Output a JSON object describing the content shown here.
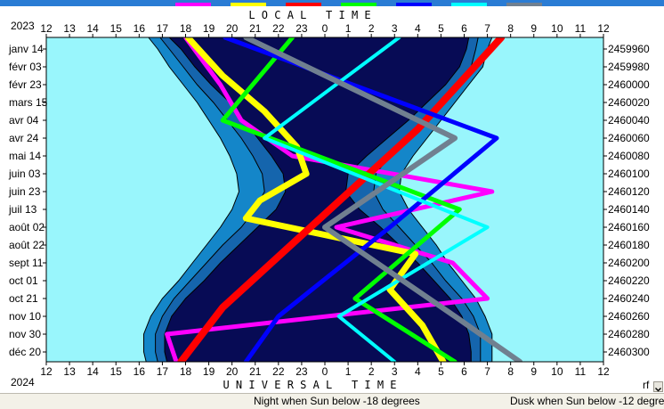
{
  "colors": {
    "outside": "#99f6fc",
    "night": "#070b55",
    "twilight_mid": "#1565ad",
    "twilight_outer": "#1486c9",
    "title_bar": "#2a7cd4"
  },
  "legend_bar": {
    "colors": [
      "#ff00ff",
      "#ffff00",
      "#ff0000",
      "#00ff00",
      "#0000ff",
      "#00ffff",
      "#708090"
    ]
  },
  "chart_data": {
    "type": "area",
    "title_top": "LOCAL TIME",
    "title_bottom": "UNIVERSAL TIME",
    "year_top": "2023",
    "year_bottom": "2024",
    "corner_label": "rf",
    "x_ticks_top": [
      "12",
      "13",
      "14",
      "15",
      "16",
      "17",
      "18",
      "19",
      "20",
      "21",
      "22",
      "23",
      "0",
      "1",
      "2",
      "3",
      "4",
      "5",
      "6",
      "7",
      "8",
      "9",
      "10",
      "11",
      "12"
    ],
    "x_ticks_bottom": [
      "12",
      "13",
      "14",
      "15",
      "16",
      "17",
      "18",
      "19",
      "20",
      "21",
      "22",
      "23",
      "0",
      "1",
      "2",
      "3",
      "4",
      "5",
      "6",
      "7",
      "8",
      "9",
      "10",
      "11",
      "12"
    ],
    "y_ticks_left": [
      "janv 14",
      "févr 03",
      "févr 23",
      "mars 15",
      "avr 04",
      "avr 24",
      "mai 14",
      "juin 03",
      "juin 23",
      "juil 13",
      "août 02",
      "août 22",
      "sept 11",
      "oct 01",
      "oct 21",
      "nov 10",
      "nov 30",
      "déc 20"
    ],
    "y_ticks_right": [
      "2459960",
      "2459980",
      "2460000",
      "2460020",
      "2460040",
      "2460060",
      "2460080",
      "2460100",
      "2460120",
      "2460140",
      "2460160",
      "2460180",
      "2460200",
      "2460220",
      "2460240",
      "2460260",
      "2460280",
      "2460300"
    ],
    "xlim_hours": [
      12,
      36
    ],
    "ylim_julian_day": [
      2459947,
      2460311
    ],
    "night_boundary": {
      "julian_day": [
        2459947,
        2459960,
        2459980,
        2460000,
        2460020,
        2460040,
        2460060,
        2460080,
        2460100,
        2460120,
        2460140,
        2460160,
        2460180,
        2460200,
        2460220,
        2460240,
        2460260,
        2460280,
        2460300,
        2460311
      ],
      "dusk_18": [
        17.3,
        17.8,
        18.4,
        19.1,
        19.9,
        20.5,
        21.1,
        21.7,
        22.2,
        22.3,
        21.9,
        21.1,
        20.3,
        19.5,
        18.8,
        18.0,
        17.4,
        17.1,
        17.1,
        17.2
      ],
      "dawn_18": [
        30.2,
        30.1,
        29.8,
        29.2,
        28.4,
        27.6,
        26.7,
        25.8,
        25.0,
        24.9,
        25.5,
        26.4,
        27.2,
        28.0,
        28.7,
        29.4,
        29.9,
        30.2,
        30.3,
        30.3
      ],
      "dusk_12": [
        16.9,
        17.3,
        17.9,
        18.5,
        19.2,
        19.8,
        20.4,
        20.9,
        21.3,
        21.4,
        21.0,
        20.4,
        19.6,
        18.9,
        18.2,
        17.5,
        17.0,
        16.7,
        16.7,
        16.8
      ],
      "dawn_12": [
        30.6,
        30.5,
        30.3,
        29.7,
        29.0,
        28.3,
        27.5,
        26.8,
        26.2,
        26.1,
        26.5,
        27.2,
        27.9,
        28.6,
        29.2,
        29.9,
        30.4,
        30.7,
        30.7,
        30.7
      ],
      "dusk_6": [
        16.4,
        16.8,
        17.3,
        17.9,
        18.5,
        19.0,
        19.5,
        19.9,
        20.2,
        20.3,
        20.0,
        19.5,
        18.9,
        18.3,
        17.7,
        17.0,
        16.5,
        16.2,
        16.2,
        16.3
      ],
      "dawn_6": [
        31.2,
        31.0,
        30.8,
        30.2,
        29.6,
        29.0,
        28.4,
        27.8,
        27.3,
        27.2,
        27.6,
        28.2,
        28.8,
        29.3,
        29.9,
        30.5,
        30.9,
        31.2,
        31.2,
        31.2
      ]
    },
    "planet_series": [
      {
        "color": "#ff00ff",
        "width": 5,
        "kind": "wavy",
        "julian_day": [
          2459947,
          2460000,
          2460040,
          2460080,
          2460120,
          2460160,
          2460200,
          2460240,
          2460280,
          2460311
        ],
        "hour": [
          18.0,
          19.5,
          20.4,
          22.6,
          31.2,
          24.5,
          29.5,
          31.0,
          17.2,
          17.6
        ]
      },
      {
        "color": "#ffff00",
        "width": 7,
        "kind": "wavy",
        "julian_day": [
          2459947,
          2459990,
          2460030,
          2460070,
          2460100,
          2460130,
          2460150,
          2460190,
          2460230,
          2460270,
          2460311
        ],
        "hour": [
          18.1,
          19.6,
          21.4,
          22.8,
          23.2,
          21.2,
          20.6,
          27.9,
          26.8,
          28.2,
          29.1
        ]
      },
      {
        "color": "#ff0000",
        "width": 8,
        "kind": "line",
        "julian_day": [
          2459947,
          2460050,
          2460150,
          2460250,
          2460311
        ],
        "hour": [
          31.6,
          28.0,
          23.8,
          19.6,
          17.8
        ]
      },
      {
        "color": "#00ff00",
        "width": 5,
        "kind": "line",
        "julian_day": [
          2459947,
          2460040,
          2460140,
          2460240,
          2460311
        ],
        "hour": [
          22.6,
          19.6,
          29.8,
          25.3,
          29.6
        ]
      },
      {
        "color": "#0000ff",
        "width": 5,
        "kind": "line",
        "julian_day": [
          2459947,
          2460060,
          2460160,
          2460260,
          2460311
        ],
        "hour": [
          19.7,
          31.4,
          26.8,
          22.0,
          20.6
        ]
      },
      {
        "color": "#00ffff",
        "width": 4,
        "kind": "line",
        "julian_day": [
          2459947,
          2460060,
          2460160,
          2460260,
          2460311
        ],
        "hour": [
          27.2,
          21.4,
          31.0,
          24.6,
          27.0
        ]
      },
      {
        "color": "#708090",
        "width": 6,
        "kind": "line",
        "julian_day": [
          2459947,
          2460060,
          2460160,
          2460260,
          2460311
        ],
        "hour": [
          20.6,
          29.6,
          24.0,
          29.6,
          32.4
        ]
      }
    ]
  },
  "status_bar": {
    "night_text": "Night when Sun below -18 degrees",
    "dusk_text": "Dusk when Sun below -12 degrees"
  }
}
